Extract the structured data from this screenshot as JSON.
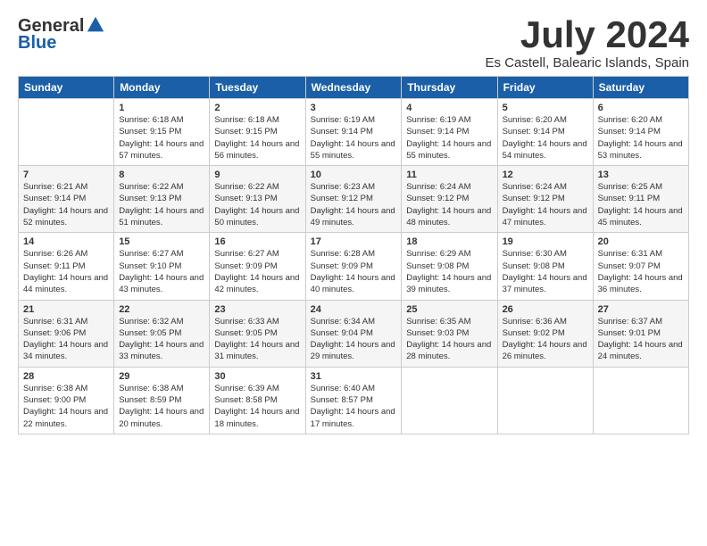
{
  "header": {
    "logo_general": "General",
    "logo_blue": "Blue",
    "month_title": "July 2024",
    "location": "Es Castell, Balearic Islands, Spain"
  },
  "days_of_week": [
    "Sunday",
    "Monday",
    "Tuesday",
    "Wednesday",
    "Thursday",
    "Friday",
    "Saturday"
  ],
  "weeks": [
    [
      {
        "day": "",
        "info": ""
      },
      {
        "day": "1",
        "info": "Sunrise: 6:18 AM\nSunset: 9:15 PM\nDaylight: 14 hours\nand 57 minutes."
      },
      {
        "day": "2",
        "info": "Sunrise: 6:18 AM\nSunset: 9:15 PM\nDaylight: 14 hours\nand 56 minutes."
      },
      {
        "day": "3",
        "info": "Sunrise: 6:19 AM\nSunset: 9:14 PM\nDaylight: 14 hours\nand 55 minutes."
      },
      {
        "day": "4",
        "info": "Sunrise: 6:19 AM\nSunset: 9:14 PM\nDaylight: 14 hours\nand 55 minutes."
      },
      {
        "day": "5",
        "info": "Sunrise: 6:20 AM\nSunset: 9:14 PM\nDaylight: 14 hours\nand 54 minutes."
      },
      {
        "day": "6",
        "info": "Sunrise: 6:20 AM\nSunset: 9:14 PM\nDaylight: 14 hours\nand 53 minutes."
      }
    ],
    [
      {
        "day": "7",
        "info": "Sunrise: 6:21 AM\nSunset: 9:14 PM\nDaylight: 14 hours\nand 52 minutes."
      },
      {
        "day": "8",
        "info": "Sunrise: 6:22 AM\nSunset: 9:13 PM\nDaylight: 14 hours\nand 51 minutes."
      },
      {
        "day": "9",
        "info": "Sunrise: 6:22 AM\nSunset: 9:13 PM\nDaylight: 14 hours\nand 50 minutes."
      },
      {
        "day": "10",
        "info": "Sunrise: 6:23 AM\nSunset: 9:12 PM\nDaylight: 14 hours\nand 49 minutes."
      },
      {
        "day": "11",
        "info": "Sunrise: 6:24 AM\nSunset: 9:12 PM\nDaylight: 14 hours\nand 48 minutes."
      },
      {
        "day": "12",
        "info": "Sunrise: 6:24 AM\nSunset: 9:12 PM\nDaylight: 14 hours\nand 47 minutes."
      },
      {
        "day": "13",
        "info": "Sunrise: 6:25 AM\nSunset: 9:11 PM\nDaylight: 14 hours\nand 45 minutes."
      }
    ],
    [
      {
        "day": "14",
        "info": "Sunrise: 6:26 AM\nSunset: 9:11 PM\nDaylight: 14 hours\nand 44 minutes."
      },
      {
        "day": "15",
        "info": "Sunrise: 6:27 AM\nSunset: 9:10 PM\nDaylight: 14 hours\nand 43 minutes."
      },
      {
        "day": "16",
        "info": "Sunrise: 6:27 AM\nSunset: 9:09 PM\nDaylight: 14 hours\nand 42 minutes."
      },
      {
        "day": "17",
        "info": "Sunrise: 6:28 AM\nSunset: 9:09 PM\nDaylight: 14 hours\nand 40 minutes."
      },
      {
        "day": "18",
        "info": "Sunrise: 6:29 AM\nSunset: 9:08 PM\nDaylight: 14 hours\nand 39 minutes."
      },
      {
        "day": "19",
        "info": "Sunrise: 6:30 AM\nSunset: 9:08 PM\nDaylight: 14 hours\nand 37 minutes."
      },
      {
        "day": "20",
        "info": "Sunrise: 6:31 AM\nSunset: 9:07 PM\nDaylight: 14 hours\nand 36 minutes."
      }
    ],
    [
      {
        "day": "21",
        "info": "Sunrise: 6:31 AM\nSunset: 9:06 PM\nDaylight: 14 hours\nand 34 minutes."
      },
      {
        "day": "22",
        "info": "Sunrise: 6:32 AM\nSunset: 9:05 PM\nDaylight: 14 hours\nand 33 minutes."
      },
      {
        "day": "23",
        "info": "Sunrise: 6:33 AM\nSunset: 9:05 PM\nDaylight: 14 hours\nand 31 minutes."
      },
      {
        "day": "24",
        "info": "Sunrise: 6:34 AM\nSunset: 9:04 PM\nDaylight: 14 hours\nand 29 minutes."
      },
      {
        "day": "25",
        "info": "Sunrise: 6:35 AM\nSunset: 9:03 PM\nDaylight: 14 hours\nand 28 minutes."
      },
      {
        "day": "26",
        "info": "Sunrise: 6:36 AM\nSunset: 9:02 PM\nDaylight: 14 hours\nand 26 minutes."
      },
      {
        "day": "27",
        "info": "Sunrise: 6:37 AM\nSunset: 9:01 PM\nDaylight: 14 hours\nand 24 minutes."
      }
    ],
    [
      {
        "day": "28",
        "info": "Sunrise: 6:38 AM\nSunset: 9:00 PM\nDaylight: 14 hours\nand 22 minutes."
      },
      {
        "day": "29",
        "info": "Sunrise: 6:38 AM\nSunset: 8:59 PM\nDaylight: 14 hours\nand 20 minutes."
      },
      {
        "day": "30",
        "info": "Sunrise: 6:39 AM\nSunset: 8:58 PM\nDaylight: 14 hours\nand 18 minutes."
      },
      {
        "day": "31",
        "info": "Sunrise: 6:40 AM\nSunset: 8:57 PM\nDaylight: 14 hours\nand 17 minutes."
      },
      {
        "day": "",
        "info": ""
      },
      {
        "day": "",
        "info": ""
      },
      {
        "day": "",
        "info": ""
      }
    ]
  ]
}
